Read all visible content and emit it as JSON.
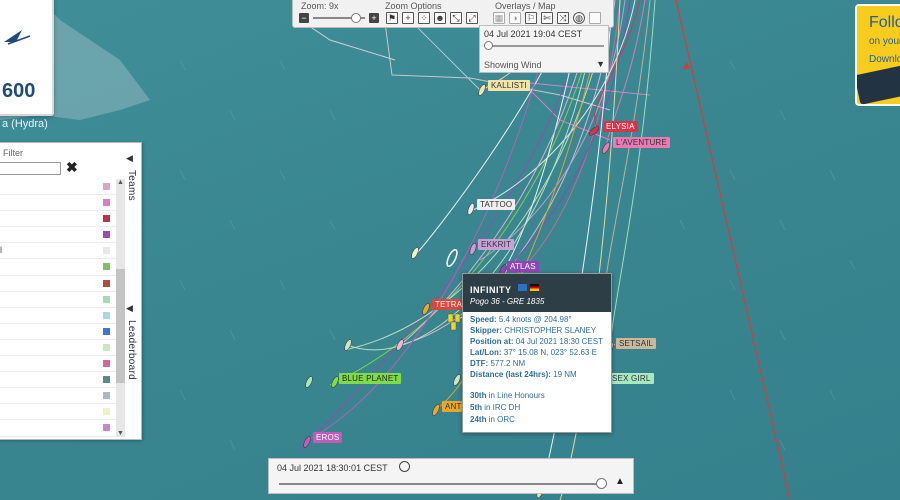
{
  "map": {
    "island_label": "a (Hydra)",
    "logo_text": "600",
    "colors": {
      "sea": "#3a8791",
      "land": "#8fb8c0"
    }
  },
  "toolbar": {
    "zoom_label": "Zoom: 9x",
    "zoom_options_label": "Zoom Options",
    "overlays_label": "Overlays / Map",
    "zoom_minus": "−",
    "zoom_plus": "+",
    "icons": [
      "flag-icon",
      "add-icon",
      "dots-icon",
      "team-icon",
      "fit-icon",
      "expand-icon",
      "grid-icon",
      "contrast-icon",
      "wind-icon",
      "tools-icon",
      "shuffle-icon",
      "globe-icon",
      "square-icon"
    ]
  },
  "time_panel": {
    "timestamp": "04 Jul 2021 19:04 CEST",
    "wind_label": "Showing Wind",
    "arrow": "▼"
  },
  "promo": {
    "line1": "Follo",
    "line2": "on your",
    "line3": "Downloa"
  },
  "left_panel": {
    "filter_label": "Filter",
    "filter_value": "",
    "clear_icon": "✖",
    "teams_tab": "Teams",
    "leaderboard_tab": "Leaderboard",
    "tab_arrow": "◀",
    "rows": [
      {
        "text": "",
        "color": "#d9a6c9"
      },
      {
        "text": "",
        "color": "#e07cc2"
      },
      {
        "text": "",
        "color": "#b8324a"
      },
      {
        "text": "",
        "color": "#9a4ab0"
      },
      {
        "text": "l",
        "color": "#e8e8e8"
      },
      {
        "text": "",
        "color": "#7cc06a"
      },
      {
        "text": "",
        "color": "#b24a3e"
      },
      {
        "text": "",
        "color": "#a8d6b8"
      },
      {
        "text": "",
        "color": "#a8d8e4"
      },
      {
        "text": "",
        "color": "#3a78d6"
      },
      {
        "text": "",
        "color": "#c8e8c0"
      },
      {
        "text": "",
        "color": "#d4689a"
      },
      {
        "text": "",
        "color": "#5a8a86"
      },
      {
        "text": "",
        "color": "#aab8c4"
      },
      {
        "text": "",
        "color": "#eef0c8"
      },
      {
        "text": "",
        "color": "#c888c8"
      }
    ]
  },
  "boats": [
    {
      "label": "KALLISTI",
      "bg": "#f3e3a6",
      "fg": "#333"
    },
    {
      "label": "ELYSIA",
      "bg": "#d9334c",
      "fg": "#fff"
    },
    {
      "label": "L'AVENTURE",
      "bg": "#ea79b4",
      "fg": "#333"
    },
    {
      "label": "TATTOO",
      "bg": "#eeeeee",
      "fg": "#333"
    },
    {
      "label": "EKKRIT",
      "bg": "#c8a0d8",
      "fg": "#333"
    },
    {
      "label": "ATLAS",
      "bg": "#8f45b3",
      "fg": "#fff"
    },
    {
      "label": "TETRA",
      "bg": "#d9473d",
      "fg": "#fff"
    },
    {
      "label": "SETSAIL",
      "bg": "#c9b89a",
      "fg": "#333"
    },
    {
      "label": "BLUE PLANET",
      "bg": "#7fdc48",
      "fg": "#222"
    },
    {
      "label": "SEX GIRL",
      "bg": "#a8e8c0",
      "fg": "#333"
    },
    {
      "label": "ANT",
      "bg": "#e8a82a",
      "fg": "#333"
    },
    {
      "label": "EROS",
      "bg": "#c25bb9",
      "fg": "#fff"
    }
  ],
  "info": {
    "name": "INFINITY",
    "subtitle": "Pogo 36 - GRE 1835",
    "speed_label": "Speed:",
    "speed_value": "5.4 knots @ 204.98°",
    "skipper_label": "Skipper:",
    "skipper_value": "CHRISTOPHER SLANEY",
    "position_label": "Position at:",
    "position_value": "04 Jul 2021 18:30 CEST",
    "latlon_label": "Lat/Lon:",
    "latlon_value": "37° 15.08 N, 023° 52.63 E",
    "dtf_label": "DTF:",
    "dtf_value": "577.2 NM",
    "distance_label": "Distance (last 24hrs):",
    "distance_value": "19 NM",
    "rank1_pos": "30th",
    "rank1_text": "in Line Honours",
    "rank2_pos": "5th",
    "rank2_text": "in IRC DH",
    "rank3_pos": "24th",
    "rank3_text": "in ORC"
  },
  "timebar": {
    "timestamp": "04 Jul 2021 18:30:01 CEST",
    "play_icon": "▲"
  }
}
